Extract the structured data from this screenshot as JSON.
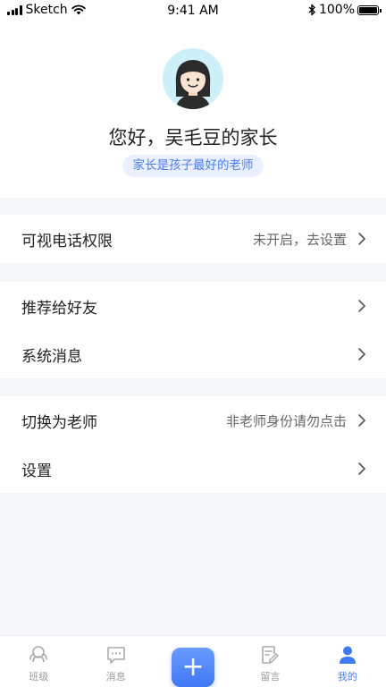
{
  "status_bar": {
    "carrier": "Sketch",
    "time": "9:41 AM",
    "battery": "100%"
  },
  "profile": {
    "greeting": "您好，吴毛豆的家长",
    "tagline": "家长是孩子最好的老师"
  },
  "menu": {
    "video_call": {
      "label": "可视电话权限",
      "value": "未开启，去设置"
    },
    "recommend": {
      "label": "推荐给好友"
    },
    "system_messages": {
      "label": "系统消息"
    },
    "switch_teacher": {
      "label": "切换为老师",
      "value": "非老师身份请勿点击"
    },
    "settings": {
      "label": "设置"
    }
  },
  "tabbar": {
    "class": "班级",
    "messages": "消息",
    "add": "+",
    "notes": "留言",
    "mine": "我的"
  },
  "colors": {
    "accent": "#4a7cf0",
    "background": "#f5f6fa"
  }
}
